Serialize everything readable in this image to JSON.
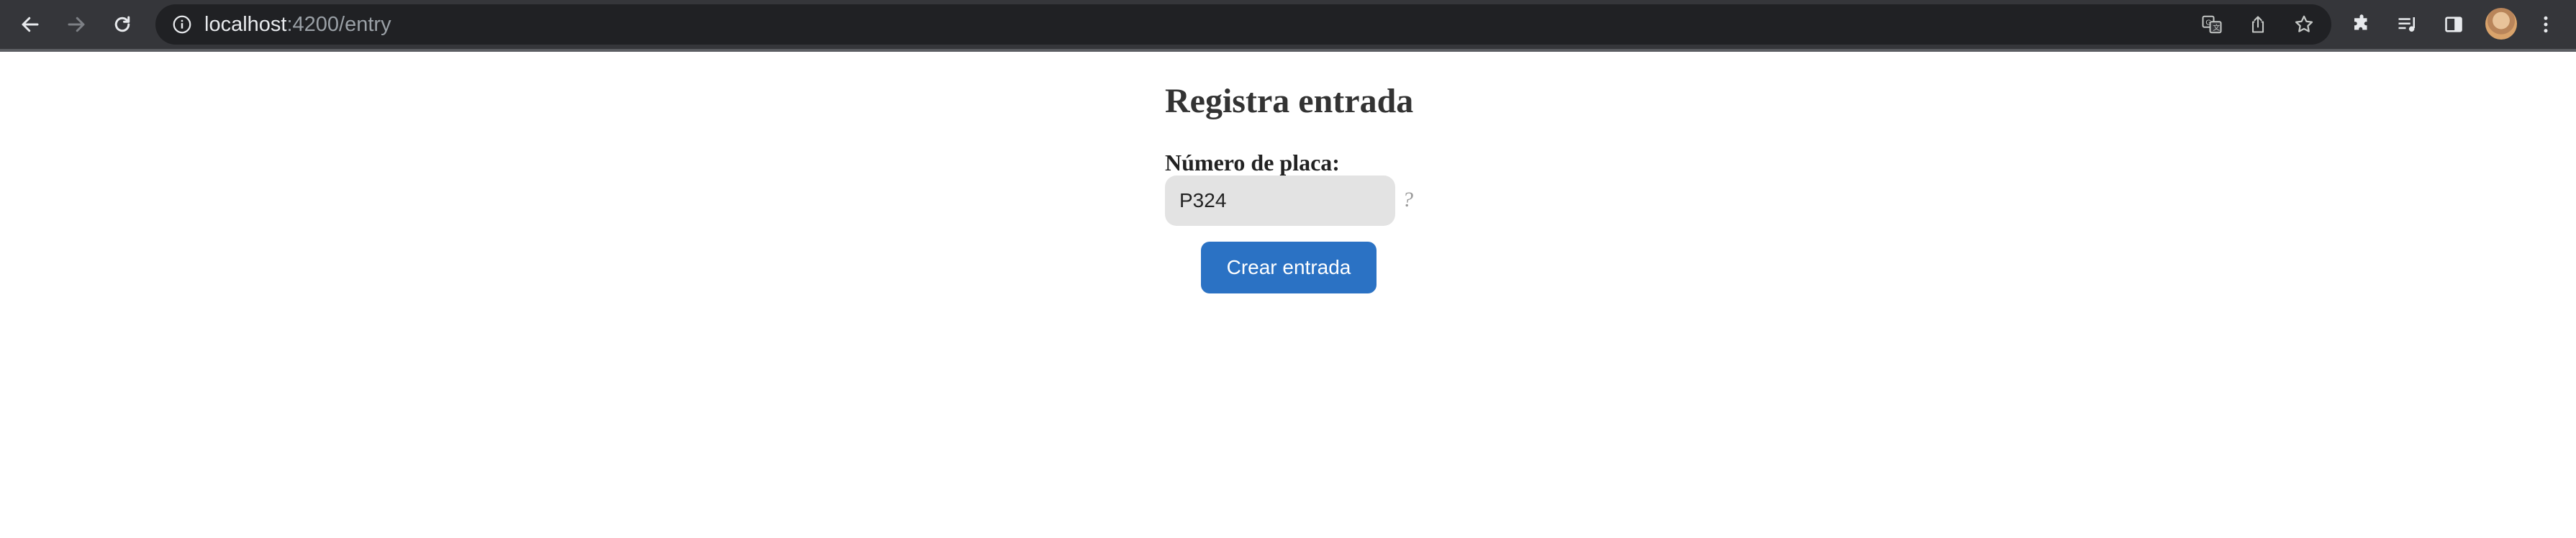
{
  "browser": {
    "url_host": "localhost",
    "url_path": ":4200/entry",
    "toolbar_icons": [
      "back-icon",
      "forward-icon",
      "reload-icon",
      "site-info-icon",
      "translate-icon",
      "share-icon",
      "bookmark-star-icon",
      "extensions-icon",
      "media-control-icon",
      "side-panel-icon",
      "profile-avatar",
      "menu-icon"
    ]
  },
  "page": {
    "title": "Registra entrada",
    "plate_label": "Número de placa:",
    "plate_value": "P324",
    "help_mark": "?",
    "submit_label": "Crear entrada"
  },
  "colors": {
    "toolbar_bg": "#35363a",
    "omnibox_bg": "#202124",
    "button_bg": "#2b72c4",
    "input_bg": "#e3e3e3"
  }
}
